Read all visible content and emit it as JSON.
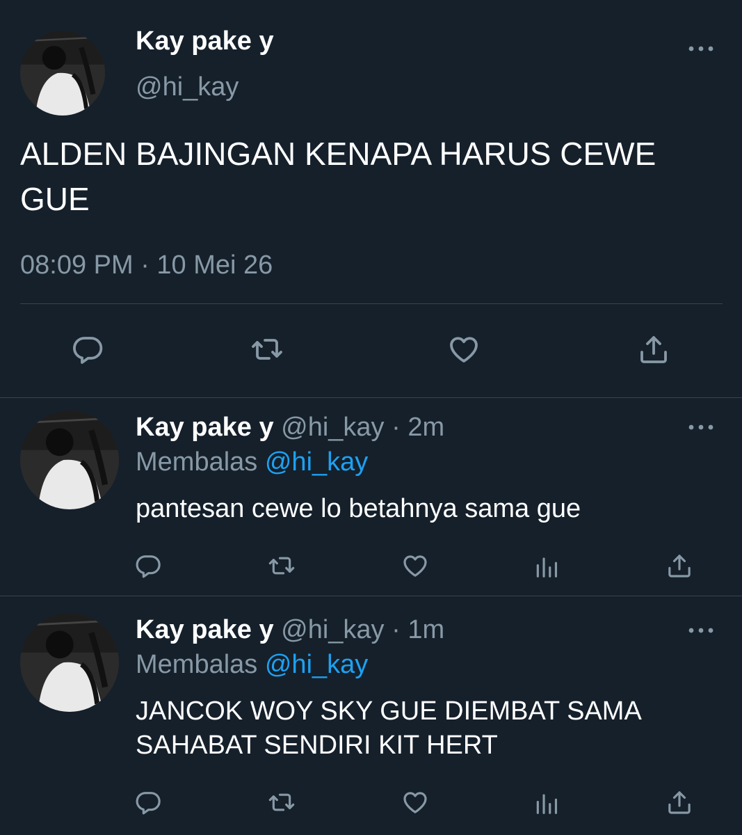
{
  "colors": {
    "background": "#15202b",
    "text": "#ffffff",
    "muted": "#8899a6",
    "link": "#1da1f2",
    "divider": "#38444d"
  },
  "main_tweet": {
    "display_name": "Kay pake y",
    "handle": "@hi_kay",
    "text_line1": "ALDEN BAJINGAN KENAPA HARUS CEWE",
    "text_line2": "GUE",
    "timestamp": "08:09 PM · 10 Mei 26",
    "actions": [
      "reply-icon",
      "retweet-icon",
      "like-icon",
      "share-icon"
    ]
  },
  "replies": [
    {
      "display_name": "Kay pake y",
      "handle": "@hi_kay",
      "time": "· 2m",
      "replying_to_label": "Membalas",
      "replying_to_handle": "@hi_kay",
      "text_lines": [
        "pantesan cewe lo betahnya sama gue"
      ],
      "actions": [
        "reply-icon",
        "retweet-icon",
        "like-icon",
        "analytics-icon",
        "share-icon"
      ]
    },
    {
      "display_name": "Kay pake y",
      "handle": "@hi_kay",
      "time": "· 1m",
      "replying_to_label": "Membalas",
      "replying_to_handle": "@hi_kay",
      "text_lines": [
        "JANCOK WOY SKY GUE DIEMBAT SAMA",
        "SAHABAT SENDIRI KIT HERT"
      ],
      "actions": [
        "reply-icon",
        "retweet-icon",
        "like-icon",
        "analytics-icon",
        "share-icon"
      ]
    }
  ]
}
